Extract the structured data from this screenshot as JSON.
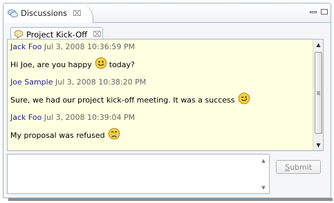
{
  "view": {
    "tab_label": "Discussions",
    "tab_close_glyph": "⌧",
    "minimize_label": "Minimize",
    "maximize_label": "Maximize"
  },
  "editor": {
    "tab_label": "Project Kick-Off",
    "tab_close_glyph": "⌧"
  },
  "messages": [
    {
      "author": "Jack Foo",
      "time": "Jul 3, 2008 10:36:59 PM",
      "text_before": "Hi Joe, are you happy",
      "smiley": "happy-smiley-icon",
      "text_after": "today?"
    },
    {
      "author": "Joe Sample",
      "time": "Jul 3, 2008 10:38:20 PM",
      "text_before": "Sure, we had our project kick-off meeting. It was a success",
      "smiley": "wink-smiley-icon",
      "text_after": ""
    },
    {
      "author": "Jack Foo",
      "time": "Jul 3, 2008 10:39:04 PM",
      "text_before": "My proposal was refused",
      "smiley": "crying-smiley-icon",
      "text_after": ""
    }
  ],
  "composer": {
    "value": "",
    "placeholder": ""
  },
  "submit": {
    "mnemonic": "S",
    "rest": "ubmit"
  },
  "colors": {
    "chat_background": "#ffffe1",
    "author": "#1e1ea0",
    "timestamp": "#666666",
    "smiley_face": "#f7d33b"
  }
}
